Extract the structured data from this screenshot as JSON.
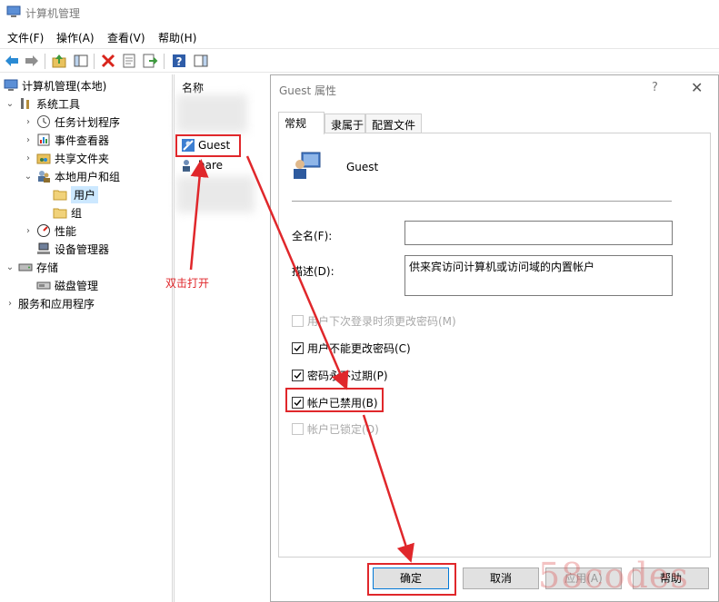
{
  "window": {
    "title": "计算机管理"
  },
  "menu": [
    "文件(F)",
    "操作(A)",
    "查看(V)",
    "帮助(H)"
  ],
  "toolbar_icons": [
    "back-icon",
    "forward-icon",
    "up-folder-icon",
    "show-hide-tree-icon",
    "delete-icon",
    "properties-icon",
    "export-icon",
    "help-icon",
    "action-pane-icon"
  ],
  "tree": {
    "root": "计算机管理(本地)",
    "items": [
      {
        "label": "系统工具",
        "icon": "tools-icon"
      },
      {
        "label": "任务计划程序",
        "icon": "clock-icon"
      },
      {
        "label": "事件查看器",
        "icon": "event-viewer-icon"
      },
      {
        "label": "共享文件夹",
        "icon": "shared-folder-icon"
      },
      {
        "label": "本地用户和组",
        "icon": "users-group-icon"
      },
      {
        "label": "用户",
        "icon": "folder-icon"
      },
      {
        "label": "组",
        "icon": "folder-icon"
      },
      {
        "label": "性能",
        "icon": "performance-icon"
      },
      {
        "label": "设备管理器",
        "icon": "device-manager-icon"
      },
      {
        "label": "存储",
        "icon": "storage-icon"
      },
      {
        "label": "磁盘管理",
        "icon": "disk-icon"
      },
      {
        "label": "服务和应用程序",
        "icon": "services-icon"
      }
    ]
  },
  "list": {
    "column": "名称",
    "items": [
      "Guest",
      "hare"
    ]
  },
  "dialog": {
    "title": "Guest 属性",
    "help": "?",
    "tabs": [
      "常规",
      "隶属于",
      "配置文件"
    ],
    "user_name": "Guest",
    "fullname_label": "全名(F):",
    "fullname_value": "",
    "desc_label": "描述(D):",
    "desc_value": "供来宾访问计算机或访问域的内置帐户",
    "checkboxes": [
      {
        "label": "用户下次登录时须更改密码(M)",
        "checked": false,
        "disabled": true
      },
      {
        "label": "用户不能更改密码(C)",
        "checked": true,
        "disabled": false
      },
      {
        "label": "密码永不过期(P)",
        "checked": true,
        "disabled": false
      },
      {
        "label": "帐户已禁用(B)",
        "checked": true,
        "disabled": false
      },
      {
        "label": "帐户已锁定(O)",
        "checked": false,
        "disabled": true
      }
    ],
    "buttons": {
      "ok": "确定",
      "cancel": "取消",
      "apply": "应用(A)",
      "help": "帮助"
    }
  },
  "annotation": {
    "text": "双击打开",
    "color": "#e0272b"
  },
  "watermark": "58codes"
}
